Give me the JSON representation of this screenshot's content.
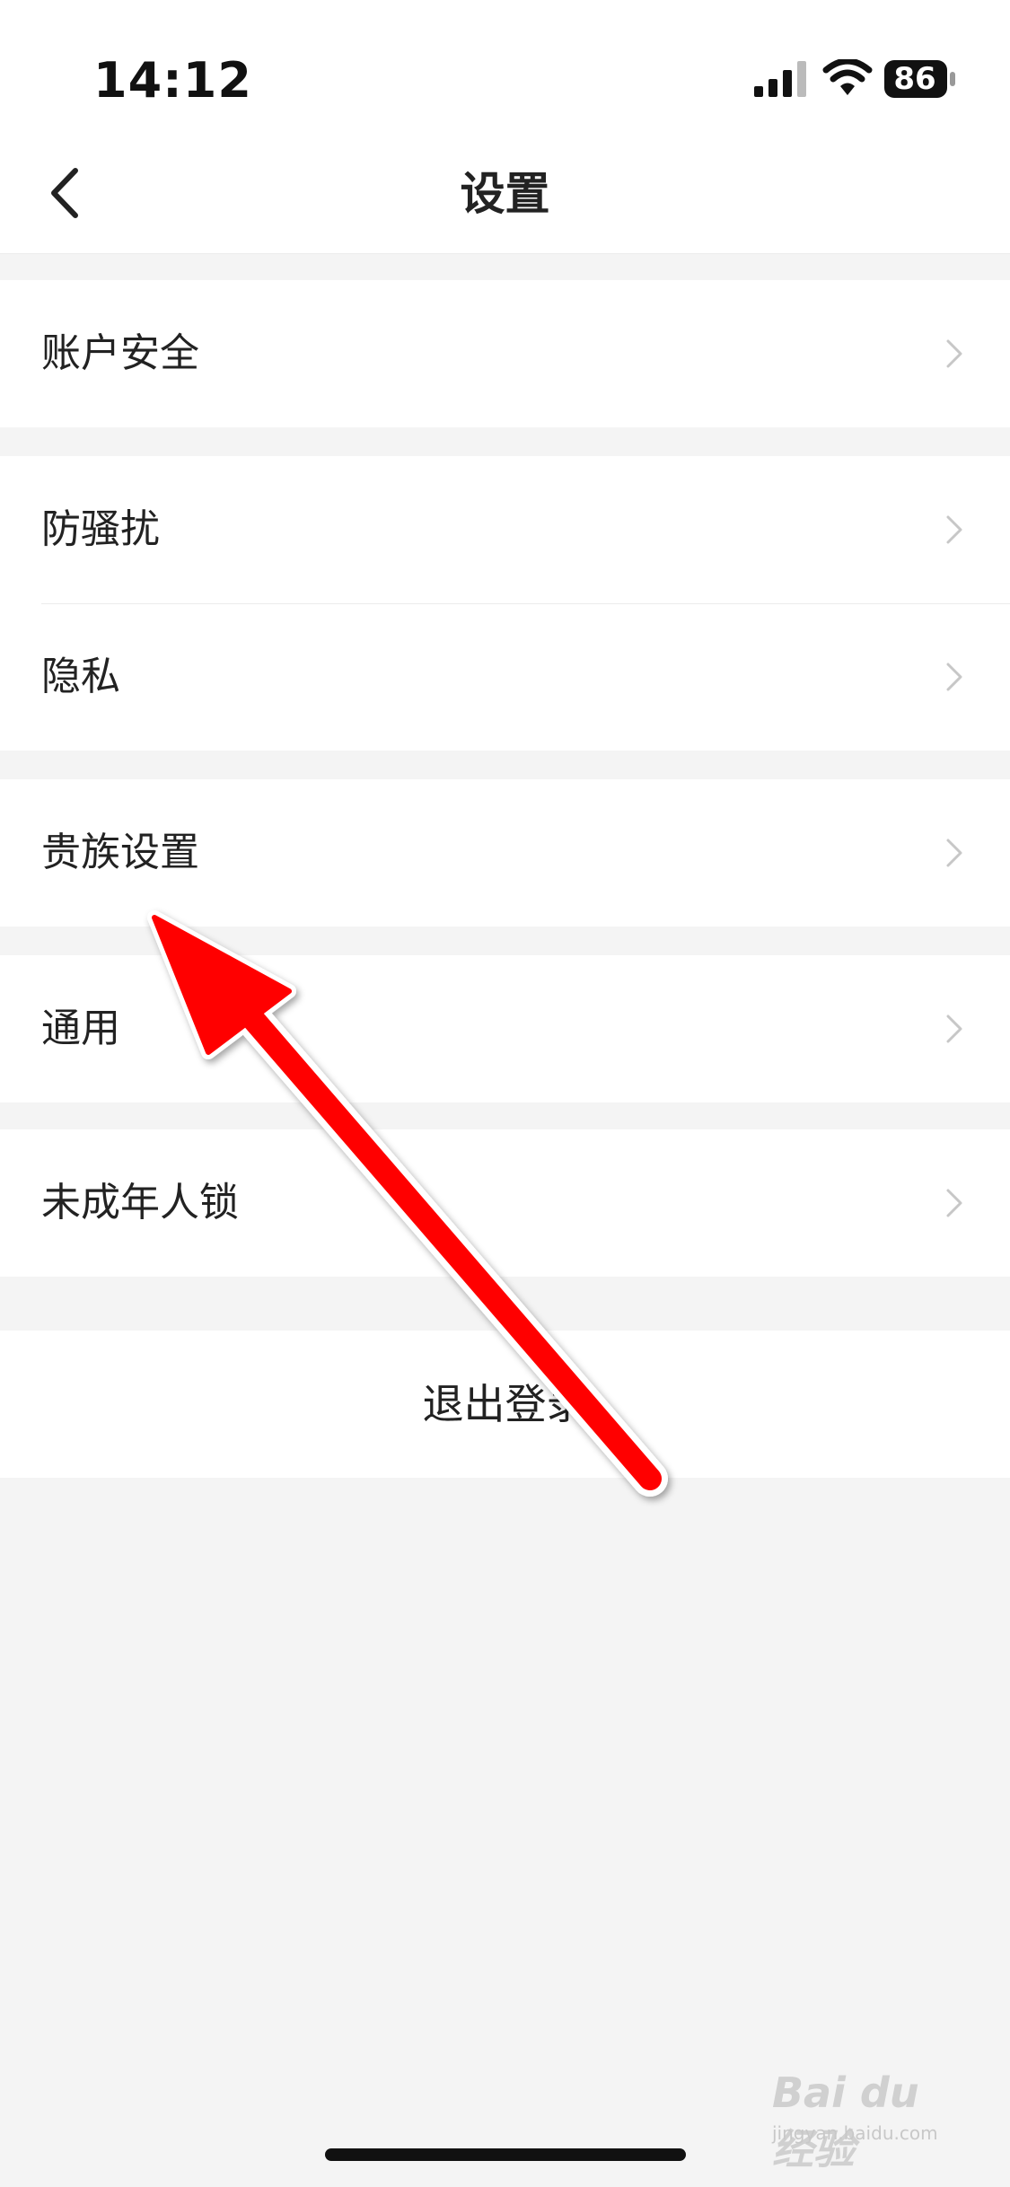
{
  "status_bar": {
    "time": "14:12",
    "battery": "86"
  },
  "nav": {
    "title": "设置",
    "back_icon": "chevron-left-icon"
  },
  "groups": [
    {
      "items": [
        {
          "label": "账户安全"
        }
      ]
    },
    {
      "items": [
        {
          "label": "防骚扰"
        },
        {
          "label": "隐私"
        }
      ]
    },
    {
      "items": [
        {
          "label": "贵族设置"
        }
      ]
    },
    {
      "items": [
        {
          "label": "通用"
        }
      ]
    },
    {
      "items": [
        {
          "label": "未成年人锁"
        }
      ]
    }
  ],
  "logout": {
    "label": "退出登录"
  },
  "annotation": {
    "color": "#ff0000",
    "icon": "red-arrow-icon"
  },
  "watermark": {
    "brand": "Bai du 经验",
    "sub": "jingyan.baidu.com"
  },
  "colors": {
    "background": "#f4f4f4",
    "surface": "#ffffff",
    "text": "#222222",
    "chevron": "#c7c7c7",
    "divider": "#ececec"
  }
}
